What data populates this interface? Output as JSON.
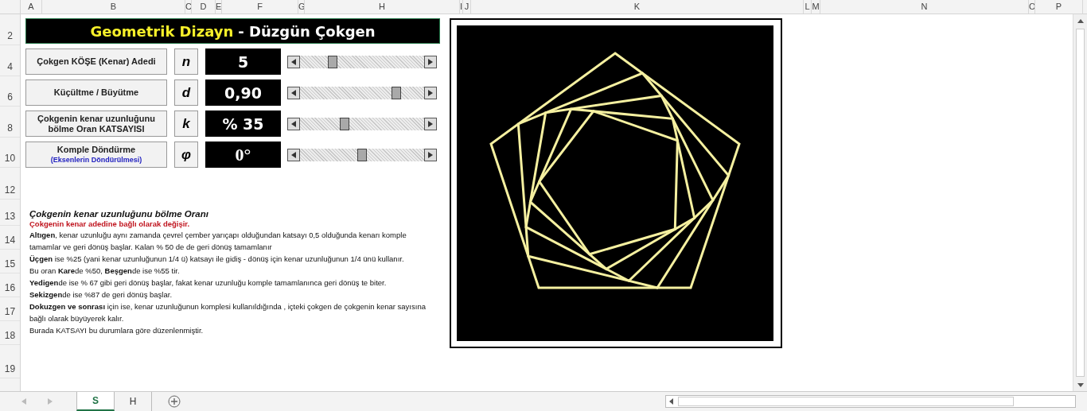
{
  "columns": [
    "A",
    "B",
    "C",
    "D",
    "E",
    "F",
    "G",
    "H",
    "I",
    "J",
    "K",
    "L",
    "M",
    "N",
    "O",
    "P"
  ],
  "rows": [
    "2",
    "4",
    "6",
    "8",
    "10",
    "12",
    "13",
    "14",
    "15",
    "16",
    "17",
    "18",
    "19"
  ],
  "title": {
    "highlight": "Geometrik Dizayn",
    "rest": "- Düzgün Çokgen"
  },
  "parameters": [
    {
      "label": "Çokgen KÖŞE (Kenar) Adedi",
      "symbol": "n",
      "value": "5",
      "level": 0.24
    },
    {
      "label": "Küçültme / Büyütme",
      "symbol": "d",
      "value": "0,90",
      "level": 0.8
    },
    {
      "label": "Çokgenin kenar uzunluğunu bölme Oran KATSAYISI",
      "symbol": "k",
      "value": "% 35",
      "level": 0.35
    },
    {
      "label": "Komple Döndürme",
      "sublabel": "(Eksenlerin Döndürülmesi)",
      "symbol": "φ",
      "value": "0°",
      "level": 0.5
    }
  ],
  "notes": [
    {
      "kind": "heading",
      "text": "Çokgenin kenar uzunluğunu bölme Oranı"
    },
    {
      "kind": "warning",
      "text": "Çokgenin kenar adedine bağlı olarak değişir."
    },
    {
      "kind": "body",
      "text": "**Altıgen**, kenar uzunluğu aynı zamanda çevrel çember yarıçapı olduğundan katsayı 0,5 olduğunda kenarı komple tamamlar ve geri dönüş başlar. Kalan % 50 de de geri dönüş tamamlanır"
    },
    {
      "kind": "body",
      "text": "**Üçgen** ise %25 (yani kenar uzunluğunun 1/4 ü) katsayı ile gidiş - dönüş için kenar uzunluğunun 1/4 ünü kullanır."
    },
    {
      "kind": "body",
      "text": "Bu oran **Kare**de %50, **Beşgen**de ise %55 tir."
    },
    {
      "kind": "body",
      "text": "**Yedigen**de ise % 67 gibi geri dönüş başlar, fakat kenar uzunluğu komple tamamlanınca geri dönüş te biter."
    },
    {
      "kind": "body",
      "text": "**Sekizgen**de ise %87 de geri dönüş başlar."
    },
    {
      "kind": "body",
      "text": "**Dokuzgen ve sonrası** için ise, kenar uzunluğunun komplesi kullanıldığında , içteki çokgen de çokgenin kenar sayısına bağlı olarak büyüyerek kalır."
    },
    {
      "kind": "body",
      "text": "Burada KATSAYI  bu durumlara göre düzenlenmiştir."
    }
  ],
  "sheet_tabs": [
    {
      "label": "S",
      "selected": true
    },
    {
      "label": "H",
      "selected": false
    }
  ]
}
